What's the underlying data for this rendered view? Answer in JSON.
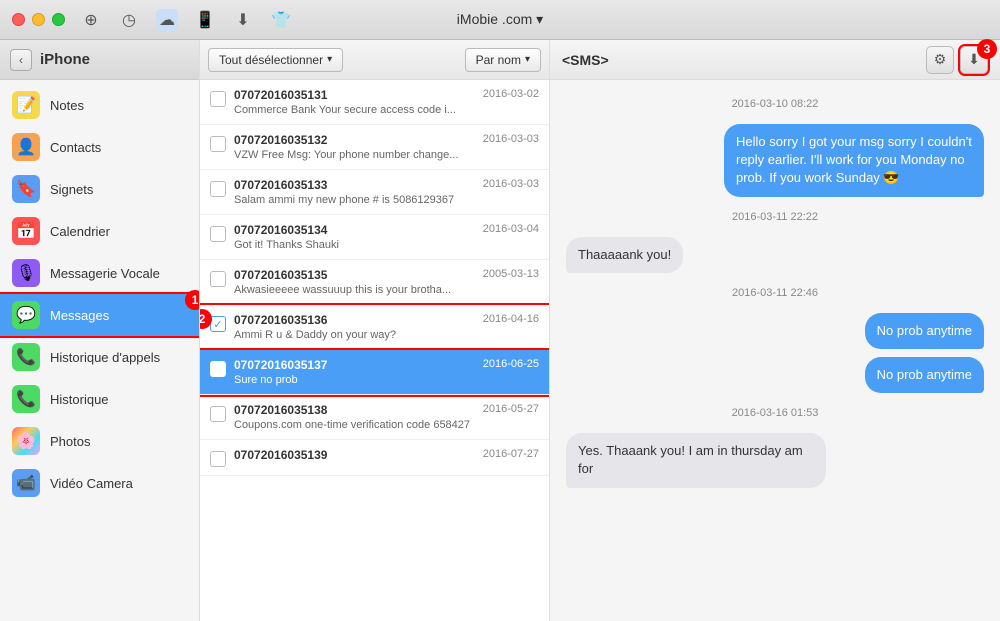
{
  "titlebar": {
    "title": "iMobie .com ▾",
    "icons": [
      "pin",
      "clock",
      "cloud",
      "phone",
      "download",
      "shirt"
    ]
  },
  "sidebar": {
    "back_label": "‹",
    "title": "iPhone",
    "items": [
      {
        "id": "notes",
        "label": "Notes",
        "icon": "📝",
        "icon_class": "icon-notes"
      },
      {
        "id": "contacts",
        "label": "Contacts",
        "icon": "👤",
        "icon_class": "icon-contacts"
      },
      {
        "id": "signets",
        "label": "Signets",
        "icon": "🔖",
        "icon_class": "icon-signets"
      },
      {
        "id": "calendar",
        "label": "Calendrier",
        "icon": "📅",
        "icon_class": "icon-calendar"
      },
      {
        "id": "voicemail",
        "label": "Messagerie Vocale",
        "icon": "🎙",
        "icon_class": "icon-voicemail"
      },
      {
        "id": "messages",
        "label": "Messages",
        "icon": "💬",
        "icon_class": "icon-messages",
        "active": true
      },
      {
        "id": "call-history",
        "label": "Historique d'appels",
        "icon": "📞",
        "icon_class": "icon-call-history"
      },
      {
        "id": "history",
        "label": "Historique",
        "icon": "📞",
        "icon_class": "icon-history"
      },
      {
        "id": "photos",
        "label": "Photos",
        "icon": "🌸",
        "icon_class": "icon-photos"
      },
      {
        "id": "video",
        "label": "Vidéo Camera",
        "icon": "📹",
        "icon_class": "icon-video"
      }
    ]
  },
  "middle": {
    "toolbar": {
      "deselect_label": "Tout désélectionner",
      "sort_label": "Par nom"
    },
    "messages": [
      {
        "id": "msg1",
        "number": "07072016035131",
        "date": "2016-03-02",
        "preview": "Commerce Bank Your secure access code i...",
        "checked": false,
        "selected": false
      },
      {
        "id": "msg2",
        "number": "07072016035132",
        "date": "2016-03-03",
        "preview": "VZW Free Msg: Your phone number change...",
        "checked": false,
        "selected": false
      },
      {
        "id": "msg3",
        "number": "07072016035133",
        "date": "2016-03-03",
        "preview": "Salam ammi my new phone # is 5086129367",
        "checked": false,
        "selected": false
      },
      {
        "id": "msg4",
        "number": "07072016035134",
        "date": "2016-03-04",
        "preview": "Got it! Thanks Shauki",
        "checked": false,
        "selected": false
      },
      {
        "id": "msg5",
        "number": "07072016035135",
        "date": "2005-03-13",
        "preview": "Akwasieeeee wassuuup this is your brotha...",
        "checked": false,
        "selected": false
      },
      {
        "id": "msg6",
        "number": "07072016035136",
        "date": "2016-04-16",
        "preview": "Ammi R u & Daddy on your way?",
        "checked": true,
        "selected": false,
        "annotate": true
      },
      {
        "id": "msg7",
        "number": "07072016035137",
        "date": "2016-06-25",
        "preview": "Sure no prob",
        "checked": true,
        "selected": true
      },
      {
        "id": "msg8",
        "number": "07072016035138",
        "date": "2016-05-27",
        "preview": "Coupons.com one-time verification code 658427",
        "checked": false,
        "selected": false
      },
      {
        "id": "msg9",
        "number": "07072016035139",
        "date": "2016-07-27",
        "preview": "",
        "checked": false,
        "selected": false
      }
    ]
  },
  "chat": {
    "header_title": "<SMS>",
    "messages": [
      {
        "type": "timestamp",
        "text": "2016-03-10 08:22"
      },
      {
        "type": "sent",
        "text": "Hello sorry I got your msg sorry I couldn't reply earlier. I'll work for you Monday no prob. If you work Sunday 😎"
      },
      {
        "type": "timestamp",
        "text": "2016-03-11 22:22"
      },
      {
        "type": "received",
        "text": "Thaaaaank you!",
        "style": "gray"
      },
      {
        "type": "timestamp",
        "text": "2016-03-11 22:46"
      },
      {
        "type": "sent",
        "text": "No prob anytime"
      },
      {
        "type": "sent",
        "text": "No prob anytime"
      },
      {
        "type": "timestamp",
        "text": "2016-03-16 01:53"
      },
      {
        "type": "received",
        "text": "Yes.  Thaaank you! I am in thursday am for",
        "style": "gray"
      }
    ]
  },
  "annotations": {
    "badge1_label": "1",
    "badge2_label": "2",
    "badge3_label": "3"
  }
}
